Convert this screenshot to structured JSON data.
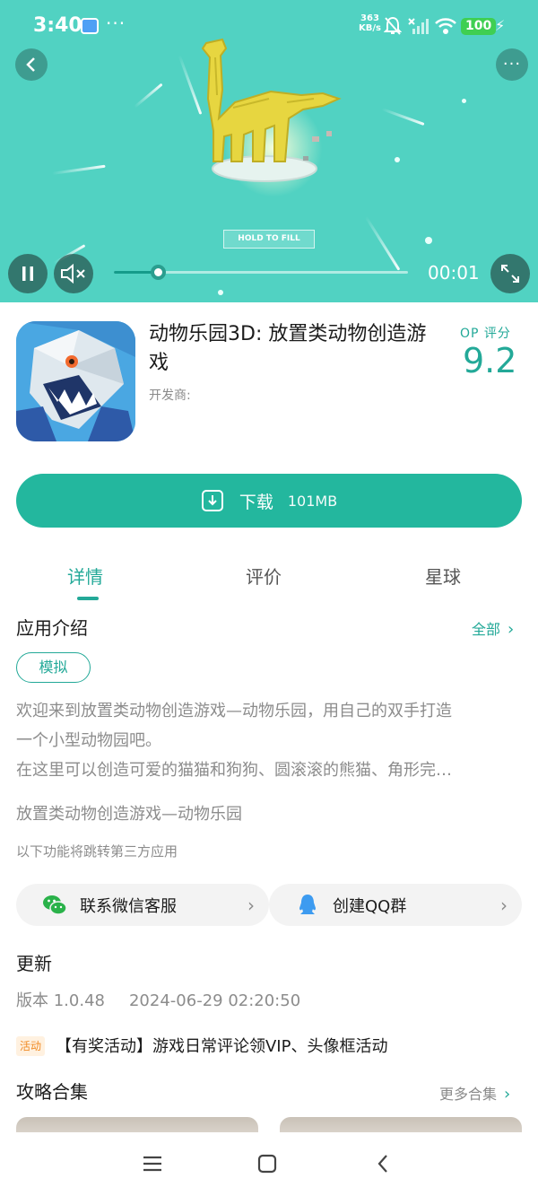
{
  "status_bar": {
    "time": "3:40",
    "net_speed_value": "363",
    "net_speed_unit": "KB/s",
    "battery": "100"
  },
  "video": {
    "overlay_label": "HOLD TO FILL",
    "time": "00:01",
    "progress": 0.15
  },
  "app": {
    "title": "动物乐园3D: 放置类动物创造游戏",
    "developer_label": "开发商:",
    "score_label": "OP 评分",
    "score": "9.2"
  },
  "download": {
    "label": "下载",
    "size": "101MB"
  },
  "tabs": [
    {
      "label": "详情",
      "active": true
    },
    {
      "label": "评价",
      "active": false
    },
    {
      "label": "星球",
      "active": false
    }
  ],
  "intro": {
    "title": "应用介绍",
    "all_link": "全部",
    "tag": "模拟",
    "desc_line1": "欢迎来到放置类动物创造游戏—动物乐园，用自己的双手打造",
    "desc_line2": "一个小型动物园吧。",
    "desc_line3": "在这里可以创造可爱的猫猫和狗狗、圆滚滚的熊猫、角形完…",
    "subtitle": "放置类动物创造游戏—动物乐园",
    "notice": "以下功能将跳转第三方应用",
    "wechat_label": "联系微信客服",
    "qq_label": "创建QQ群"
  },
  "update": {
    "title": "更新",
    "version": "版本 1.0.48",
    "date": "2024-06-29 02:20:50",
    "event_badge": "活动",
    "event_text": "【有奖活动】游戏日常评论领VIP、头像框活动"
  },
  "guides": {
    "title": "攻略合集",
    "more_link": "更多合集"
  },
  "colors": {
    "accent": "#23a998",
    "download_button": "#23b79e",
    "video_background": "#51d2c2"
  }
}
